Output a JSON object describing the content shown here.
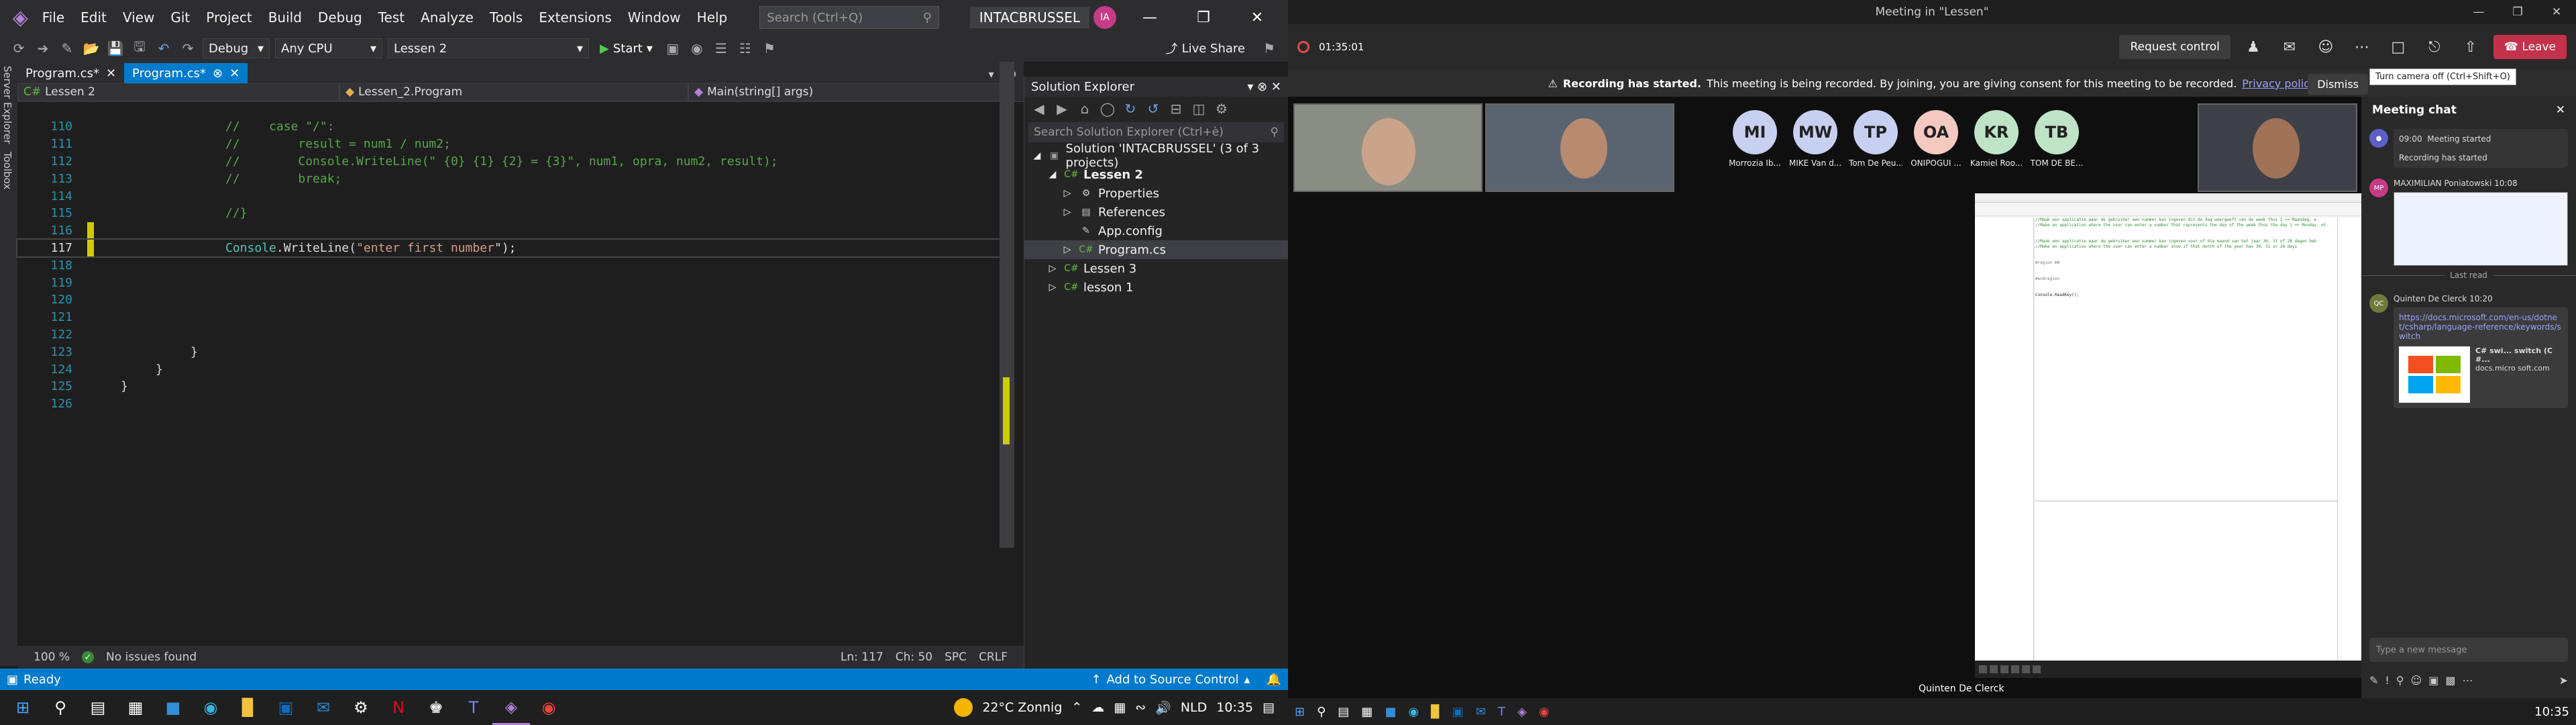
{
  "vs": {
    "menu": [
      "File",
      "Edit",
      "View",
      "Git",
      "Project",
      "Build",
      "Debug",
      "Test",
      "Analyze",
      "Tools",
      "Extensions",
      "Window",
      "Help"
    ],
    "search_placeholder": "Search (Ctrl+Q)",
    "solution_name": "INTACBRUSSEL",
    "avatar": "IA",
    "live_share": "Live Share",
    "config": "Debug",
    "platform": "Any CPU",
    "startup_project": "Lessen 2",
    "start_label": "Start",
    "side_tabs": [
      "Server Explorer",
      "Toolbox"
    ],
    "tabs": [
      {
        "label": "Program.cs*",
        "active": false
      },
      {
        "label": "Program.cs*",
        "active": true
      }
    ],
    "nav": {
      "project": "Lessen 2",
      "class": "Lessen_2.Program",
      "member": "Main(string[] args)"
    },
    "code_lines": [
      {
        "n": "110",
        "parts": [
          [
            "cmt",
            "//    case \"/\":"
          ]
        ],
        "indent": 3,
        "mod": false
      },
      {
        "n": "111",
        "parts": [
          [
            "cmt",
            "//        result = num1 / num2;"
          ]
        ],
        "indent": 3,
        "mod": false
      },
      {
        "n": "112",
        "parts": [
          [
            "cmt",
            "//        Console.WriteLine(\" {0} {1} {2} = {3}\", num1, opra, num2, result);"
          ]
        ],
        "indent": 3,
        "mod": false
      },
      {
        "n": "113",
        "parts": [
          [
            "cmt",
            "//        break;"
          ]
        ],
        "indent": 3,
        "mod": false
      },
      {
        "n": "114",
        "parts": [],
        "indent": 0,
        "mod": false
      },
      {
        "n": "115",
        "parts": [
          [
            "cmt",
            "//}"
          ]
        ],
        "indent": 3,
        "mod": false
      },
      {
        "n": "116",
        "parts": [],
        "indent": 0,
        "mod": true
      },
      {
        "n": "117",
        "parts": [
          [
            "cls",
            "Console"
          ],
          [
            "plain",
            "."
          ],
          [
            "plain",
            "WriteLine("
          ],
          [
            "str",
            "\"enter first number"
          ],
          [
            "plain",
            "\");"
          ]
        ],
        "indent": 3,
        "mod": true,
        "current": true
      },
      {
        "n": "118",
        "parts": [],
        "indent": 0,
        "mod": false
      },
      {
        "n": "119",
        "parts": [],
        "indent": 0,
        "mod": false
      },
      {
        "n": "120",
        "parts": [],
        "indent": 0,
        "mod": false
      },
      {
        "n": "121",
        "parts": [],
        "indent": 0,
        "mod": false
      },
      {
        "n": "122",
        "parts": [],
        "indent": 0,
        "mod": false
      },
      {
        "n": "123",
        "parts": [
          [
            "plain",
            "}"
          ]
        ],
        "indent": 2,
        "mod": false
      },
      {
        "n": "124",
        "parts": [
          [
            "plain",
            "}"
          ]
        ],
        "indent": 1,
        "mod": false
      },
      {
        "n": "125",
        "parts": [
          [
            "plain",
            "}"
          ]
        ],
        "indent": 0,
        "mod": false
      },
      {
        "n": "126",
        "parts": [],
        "indent": 0,
        "mod": false
      }
    ],
    "editor_status": {
      "zoom": "100 %",
      "issues": "No issues found",
      "ln": "Ln: 117",
      "ch": "Ch: 50",
      "spc": "SPC",
      "eol": "CRLF"
    },
    "solution_explorer": {
      "title": "Solution Explorer",
      "search": "Search Solution Explorer (Ctrl+è)",
      "tree": [
        {
          "label": "Solution 'INTACBRUSSEL' (3 of 3 projects)",
          "level": 0,
          "icon": "solution",
          "expanded": true
        },
        {
          "label": "Lessen 2",
          "level": 1,
          "icon": "cs-project",
          "expanded": true,
          "bold": true
        },
        {
          "label": "Properties",
          "level": 2,
          "icon": "wrench",
          "expanded": false
        },
        {
          "label": "References",
          "level": 2,
          "icon": "references",
          "expanded": false
        },
        {
          "label": "App.config",
          "level": 2,
          "icon": "config",
          "expanded": null
        },
        {
          "label": "Program.cs",
          "level": 2,
          "icon": "cs-file",
          "expanded": false,
          "selected": true
        },
        {
          "label": "Lessen 3",
          "level": 1,
          "icon": "cs-project",
          "expanded": false
        },
        {
          "label": "lesson 1",
          "level": 1,
          "icon": "cs-project",
          "expanded": false
        }
      ]
    },
    "status": {
      "ready": "Ready",
      "source_control": "Add to Source Control"
    }
  },
  "taskbar1": {
    "weather": "22°C Zonnig",
    "lang": "NLD",
    "time": "10:35"
  },
  "teams": {
    "window_title": "Meeting in \"Lessen\"",
    "timer": "01:35:01",
    "request_control": "Request control",
    "leave": "Leave",
    "recording_banner": {
      "bold": "Recording has started.",
      "text": "This meeting is being recorded. By joining, you are giving consent for this meeting to be recorded.",
      "link": "Privacy policy",
      "dismiss": "Dismiss"
    },
    "tooltip": "Turn camera off (Ctrl+Shift+O)",
    "participants": [
      {
        "initials": "MI",
        "name": "Morrozia Ib...",
        "color": "#c7d0f0"
      },
      {
        "initials": "MW",
        "name": "MIKE Van d...",
        "color": "#c7d0f0"
      },
      {
        "initials": "TP",
        "name": "Tom De Peu...",
        "color": "#c7d0f0"
      },
      {
        "initials": "OA",
        "name": "ONIPOGUI ...",
        "color": "#f4c9c0"
      },
      {
        "initials": "KR",
        "name": "Kamiel Roo...",
        "color": "#bfe3c6"
      },
      {
        "initials": "TB",
        "name": "TOM DE BE...",
        "color": "#bfe3c6"
      }
    ],
    "presenter_label": "Quinten De Clerck",
    "shared_code": [
      "//Maak een applicatie waar de gebruiker een nummer kan ingeven dit de dag weergeeft van de week thus 1 => Maandag, e",
      "//Make an application where the user can enter a number that represents the day of the week thus the day 1 => Monday, et",
      "",
      "",
      "//Maak een applicatie waar de gebruiker een nummer kan ingeven voor of die maand van het jaar 30, 31 of 28 dagen heb",
      "//Make an application where the user can enter a number show if that month of the year has 30, 31 or 28 days",
      "",
      "",
      "#region ##",
      "",
      "",
      "#endregion",
      "",
      "",
      "Console.ReadKey();"
    ],
    "chat": {
      "title": "Meeting chat",
      "messages": [
        {
          "time": "09:00",
          "text": "Meeting started"
        },
        {
          "time": "",
          "text": "Recording has started"
        }
      ],
      "user_msg": {
        "initials": "MP",
        "author": "MAXIMILIAN Poniatowski",
        "time": "10:08"
      },
      "last_read": "Last read",
      "link_msg": {
        "initials": "QC",
        "author": "Quinten De Clerck",
        "time": "10:20",
        "link": "https://docs.microsoft.com/en-us/dotnet/csharp/language-reference/keywords/switch",
        "card_title": "C# swi... switch (C#...",
        "card_source": "docs.micro soft.com"
      },
      "input_placeholder": "Type a new message"
    }
  },
  "taskbar2": {
    "time": "10:35"
  }
}
